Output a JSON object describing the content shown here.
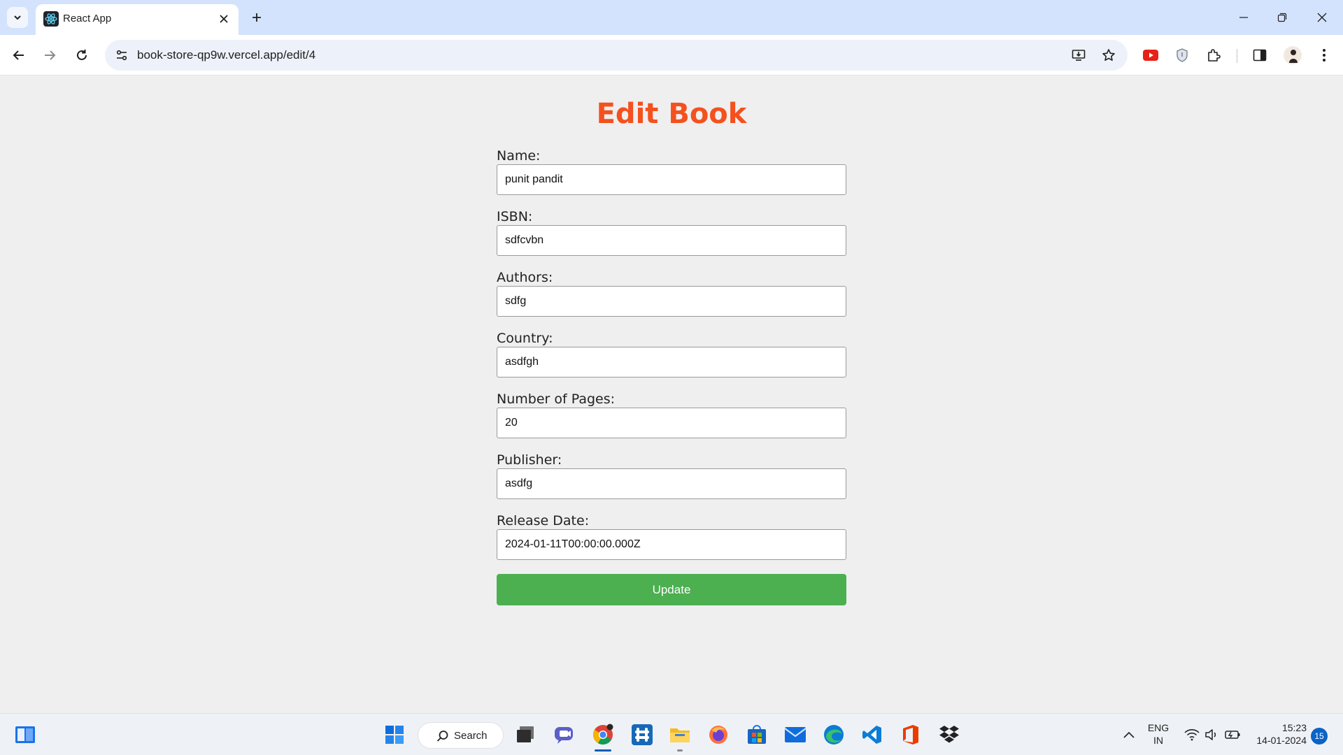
{
  "browser": {
    "tab_title": "React App",
    "url": "book-store-qp9w.vercel.app/edit/4"
  },
  "page": {
    "title": "Edit Book",
    "fields": [
      {
        "label": "Name:",
        "value": "punit pandit"
      },
      {
        "label": "ISBN:",
        "value": "sdfcvbn"
      },
      {
        "label": "Authors:",
        "value": "sdfg"
      },
      {
        "label": "Country:",
        "value": "asdfgh"
      },
      {
        "label": "Number of Pages:",
        "value": "20"
      },
      {
        "label": "Publisher:",
        "value": "asdfg"
      },
      {
        "label": "Release Date:",
        "value": "2024-01-11T00:00:00.000Z"
      }
    ],
    "update_label": "Update"
  },
  "taskbar": {
    "search_label": "Search",
    "lang_top": "ENG",
    "lang_bottom": "IN",
    "time": "15:23",
    "date": "14-01-2024",
    "notifications": "15"
  },
  "colors": {
    "title": "#f4511e",
    "button": "#4caf50",
    "page_bg": "#efefef",
    "tabstrip": "#d3e3fd"
  }
}
